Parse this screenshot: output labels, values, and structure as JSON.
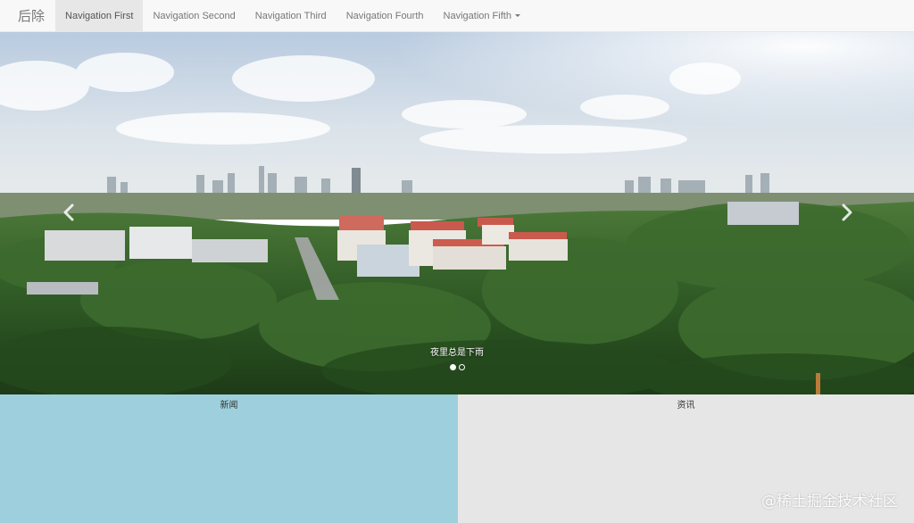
{
  "navbar": {
    "brand": "后除",
    "items": [
      {
        "label": "Navigation First",
        "active": true
      },
      {
        "label": "Navigation Second"
      },
      {
        "label": "Navigation Third"
      },
      {
        "label": "Navigation Fourth"
      },
      {
        "label": "Navigation Fifth",
        "dropdown": true
      }
    ]
  },
  "carousel": {
    "caption": "夜里总是下雨",
    "indicator_count": 2,
    "active_index": 0,
    "prev_icon": "chevron-left-icon",
    "next_icon": "chevron-right-icon"
  },
  "panels": {
    "left": {
      "title": "新闻",
      "color": "#9ecfdc"
    },
    "right": {
      "title": "资讯",
      "color": "#e6e6e6"
    }
  },
  "watermark": "@稀土掘金技术社区"
}
